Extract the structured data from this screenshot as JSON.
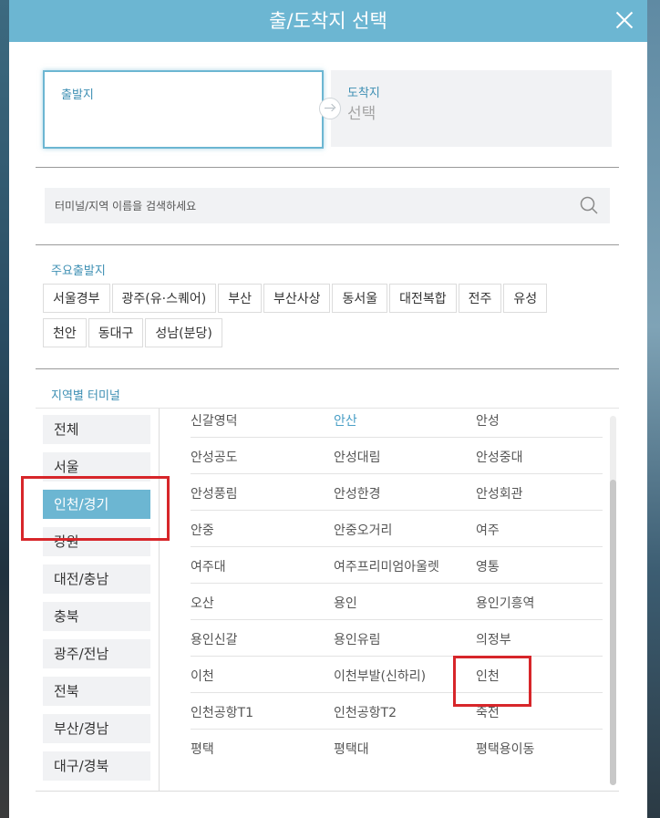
{
  "dialog": {
    "title": "출/도착지 선택",
    "close_label": "close"
  },
  "departure": {
    "label": "출발지",
    "value": ""
  },
  "arrival": {
    "label": "도착지",
    "value": "선택"
  },
  "search": {
    "placeholder": "터미널/지역 이름을 검색하세요"
  },
  "major_departures": {
    "title": "주요출발지",
    "items": [
      "서울경부",
      "광주(유·스퀘어)",
      "부산",
      "부산사상",
      "동서울",
      "대전복합",
      "전주",
      "유성",
      "천안",
      "동대구",
      "성남(분당)"
    ]
  },
  "regional": {
    "title": "지역별 터미널",
    "regions": [
      "전체",
      "서울",
      "인천/경기",
      "강원",
      "대전/충남",
      "충북",
      "광주/전남",
      "전북",
      "부산/경남",
      "대구/경북"
    ],
    "active_region": "인천/경기",
    "terminals": [
      [
        "신갈영덕",
        "안산",
        "안성"
      ],
      [
        "안성공도",
        "안성대림",
        "안성중대"
      ],
      [
        "안성풍림",
        "안성한경",
        "안성회관"
      ],
      [
        "안중",
        "안중오거리",
        "여주"
      ],
      [
        "여주대",
        "여주프리미엄아울렛",
        "영통"
      ],
      [
        "오산",
        "용인",
        "용인기흥역"
      ],
      [
        "용인신갈",
        "용인유림",
        "의정부"
      ],
      [
        "이천",
        "이천부발(신하리)",
        "인천"
      ],
      [
        "인천공항T1",
        "인천공항T2",
        "죽전"
      ],
      [
        "평택",
        "평택대",
        "평택용이동"
      ]
    ],
    "active_terminal": "안산"
  },
  "colors": {
    "header": "#6cb6d2",
    "accent": "#3d8fb3",
    "highlight": "#d7262a"
  }
}
